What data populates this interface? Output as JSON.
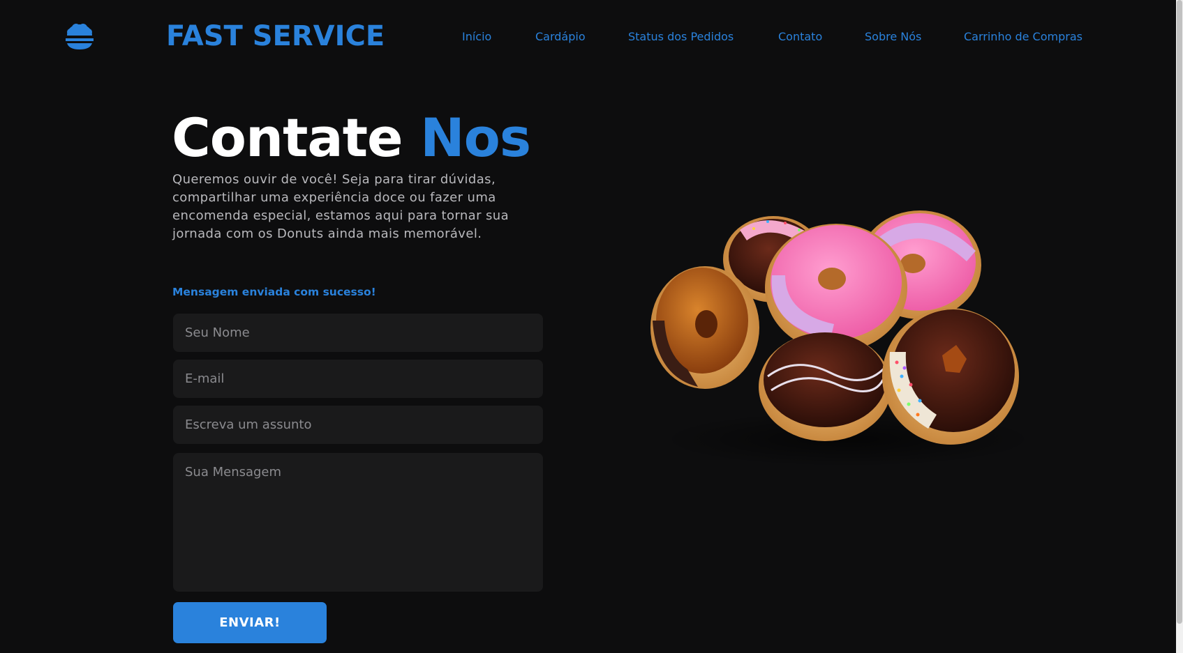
{
  "header": {
    "brand": "FAST SERVICE",
    "logo_icon": "donut-logo-icon",
    "nav": [
      {
        "label": "Início"
      },
      {
        "label": "Cardápio"
      },
      {
        "label": "Status dos Pedidos"
      },
      {
        "label": "Contato"
      },
      {
        "label": "Sobre Nós"
      },
      {
        "label": "Carrinho de Compras"
      }
    ]
  },
  "hero": {
    "title_main": "Contate",
    "title_accent": "Nos",
    "intro": "Queremos ouvir de você! Seja para tirar dúvidas, compartilhar uma experiência doce ou fazer uma encomenda especial, estamos aqui para tornar sua jornada com os Donuts ainda mais memorável."
  },
  "form": {
    "success_message": "Mensagem enviada com sucesso!",
    "name_placeholder": "Seu Nome",
    "name_value": "",
    "email_placeholder": "E-mail",
    "email_value": "",
    "subject_placeholder": "Escreva um assunto",
    "subject_value": "",
    "message_placeholder": "Sua Mensagem",
    "message_value": "",
    "submit_label": "ENVIAR!"
  },
  "colors": {
    "background": "#0d0d0e",
    "accent": "#2a82dc",
    "field_background": "#1a1a1b",
    "text_muted": "#b9b9bd"
  }
}
